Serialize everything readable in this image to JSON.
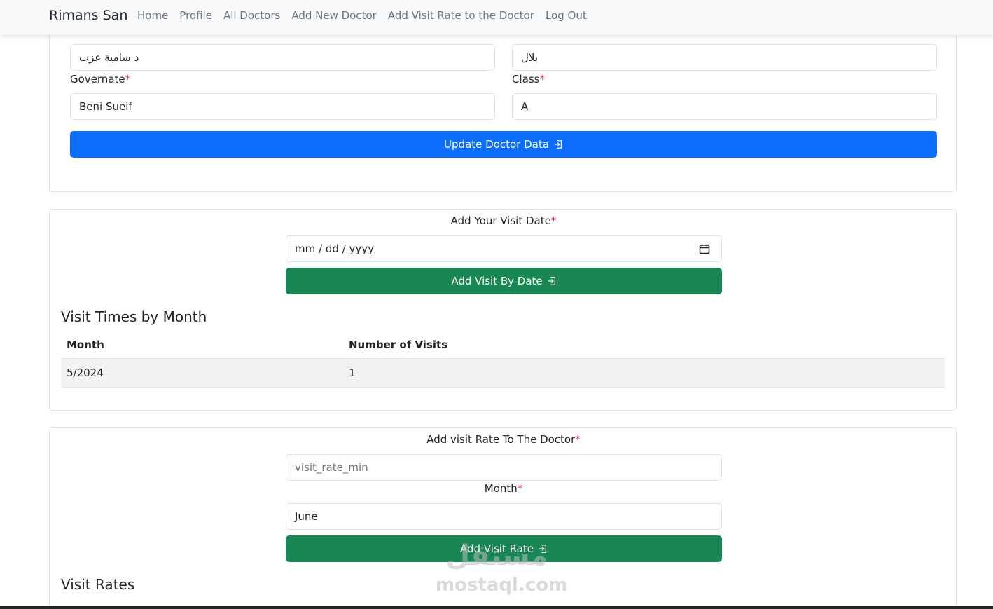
{
  "navbar": {
    "brand": "Rimans San",
    "links": [
      "Home",
      "Profile",
      "All Doctors",
      "Add New Doctor",
      "Add Visit Rate to the Doctor",
      "Log Out"
    ]
  },
  "doctor_form": {
    "name_value": "د سامية عزت",
    "area_value": "بلال",
    "governate_label": "Governate",
    "governate_value": "Beni Sueif",
    "class_label": "Class",
    "class_value": "A",
    "required_mark": "*",
    "update_button": "Update Doctor Data"
  },
  "visit_form": {
    "date_label": "Add Your Visit Date",
    "date_placeholder": "mm / dd / yyyy",
    "add_button": "Add Visit By Date"
  },
  "visit_times": {
    "title": "Visit Times by Month",
    "columns": [
      "Month",
      "Number of Visits"
    ],
    "rows": [
      [
        "5/2024",
        "1"
      ]
    ]
  },
  "rate_form": {
    "rate_label": "Add visit Rate To The Doctor",
    "rate_placeholder": "visit_rate_min",
    "month_label": "Month",
    "month_value": "June",
    "add_button": "Add Visit Rate"
  },
  "visit_rates": {
    "title": "Visit Rates"
  },
  "watermark": {
    "arabic": "مستقل",
    "latin": "mostaql.com"
  },
  "colors": {
    "primary": "#0d6efd",
    "success": "#198754",
    "required": "#dc3545"
  }
}
